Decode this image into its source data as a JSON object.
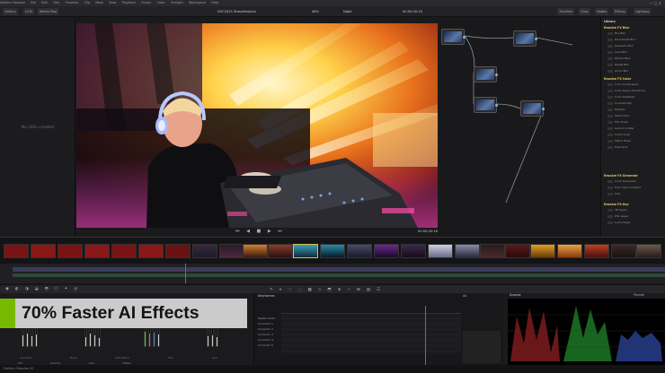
{
  "menubar": {
    "items": [
      "DaVinci Resolve",
      "File",
      "Edit",
      "Trim",
      "Timeline",
      "Clip",
      "Mark",
      "View",
      "Playback",
      "Fusion",
      "Color",
      "Fairlight",
      "Workspace",
      "Help"
    ]
  },
  "toolbar": {
    "left_buttons": [
      "Gallery",
      "LUTs",
      "Media Pool"
    ],
    "right_buttons": [
      "Timeline",
      "Clips",
      "Nodes",
      "Effects",
      "Lightbox"
    ],
    "project_title": "DVC2025 StressFestival",
    "zoom": "46%",
    "clip_name": "Night",
    "timecode": "00:00:20:10"
  },
  "gallery": {
    "empty_text": "No stills created"
  },
  "viewer": {
    "timecode": "00:00:20:16"
  },
  "nodes": {
    "count": 5
  },
  "library": {
    "title": "Library",
    "sections": [
      {
        "title": "Resolve FX Blur",
        "items": [
          "Box Blur",
          "Directional Blur",
          "Gaussian Blur",
          "Lens Blur",
          "Mosaic Blur",
          "Radial Blur",
          "Zoom Blur"
        ]
      },
      {
        "title": "Resolve FX Color",
        "items": [
          "Color Compressor",
          "Color Space Transform",
          "Color Stabilizer",
          "Contrast Pop",
          "Dehaze",
          "False Color",
          "Film Grain",
          "Gamut Limiter",
          "Invert Color",
          "Match Move",
          "Pixel Grid"
        ]
      },
      {
        "title": "Resolve FX Generate",
        "items": [
          "Color Generator",
          "Four Color Gradient",
          "Grid"
        ]
      },
      {
        "title": "Resolve FX Key",
        "items": [
          "3D Keyer",
          "HSL Keyer",
          "Luma Keyer"
        ]
      }
    ]
  },
  "keyframes": {
    "title": "Keyframes",
    "mode": "All",
    "tracks": [
      "Master Node",
      "Corrector 1",
      "Corrector 2",
      "Corrector 3",
      "Corrector 4",
      "Corrector 5"
    ]
  },
  "scopes": {
    "title": "Scopes",
    "mode": "Parade"
  },
  "color_wheels": {
    "labels": [
      "Lift",
      "Gamma",
      "Gain",
      "Offset"
    ]
  },
  "bottom_params": [
    "Contrast",
    "Pivot",
    "Saturation",
    "Hue",
    "Lum Mix"
  ],
  "statusbar": {
    "app": "DaVinci Resolve 20"
  },
  "banner": {
    "text": "70% Faster AI Effects",
    "accent_color": "#76b900"
  }
}
